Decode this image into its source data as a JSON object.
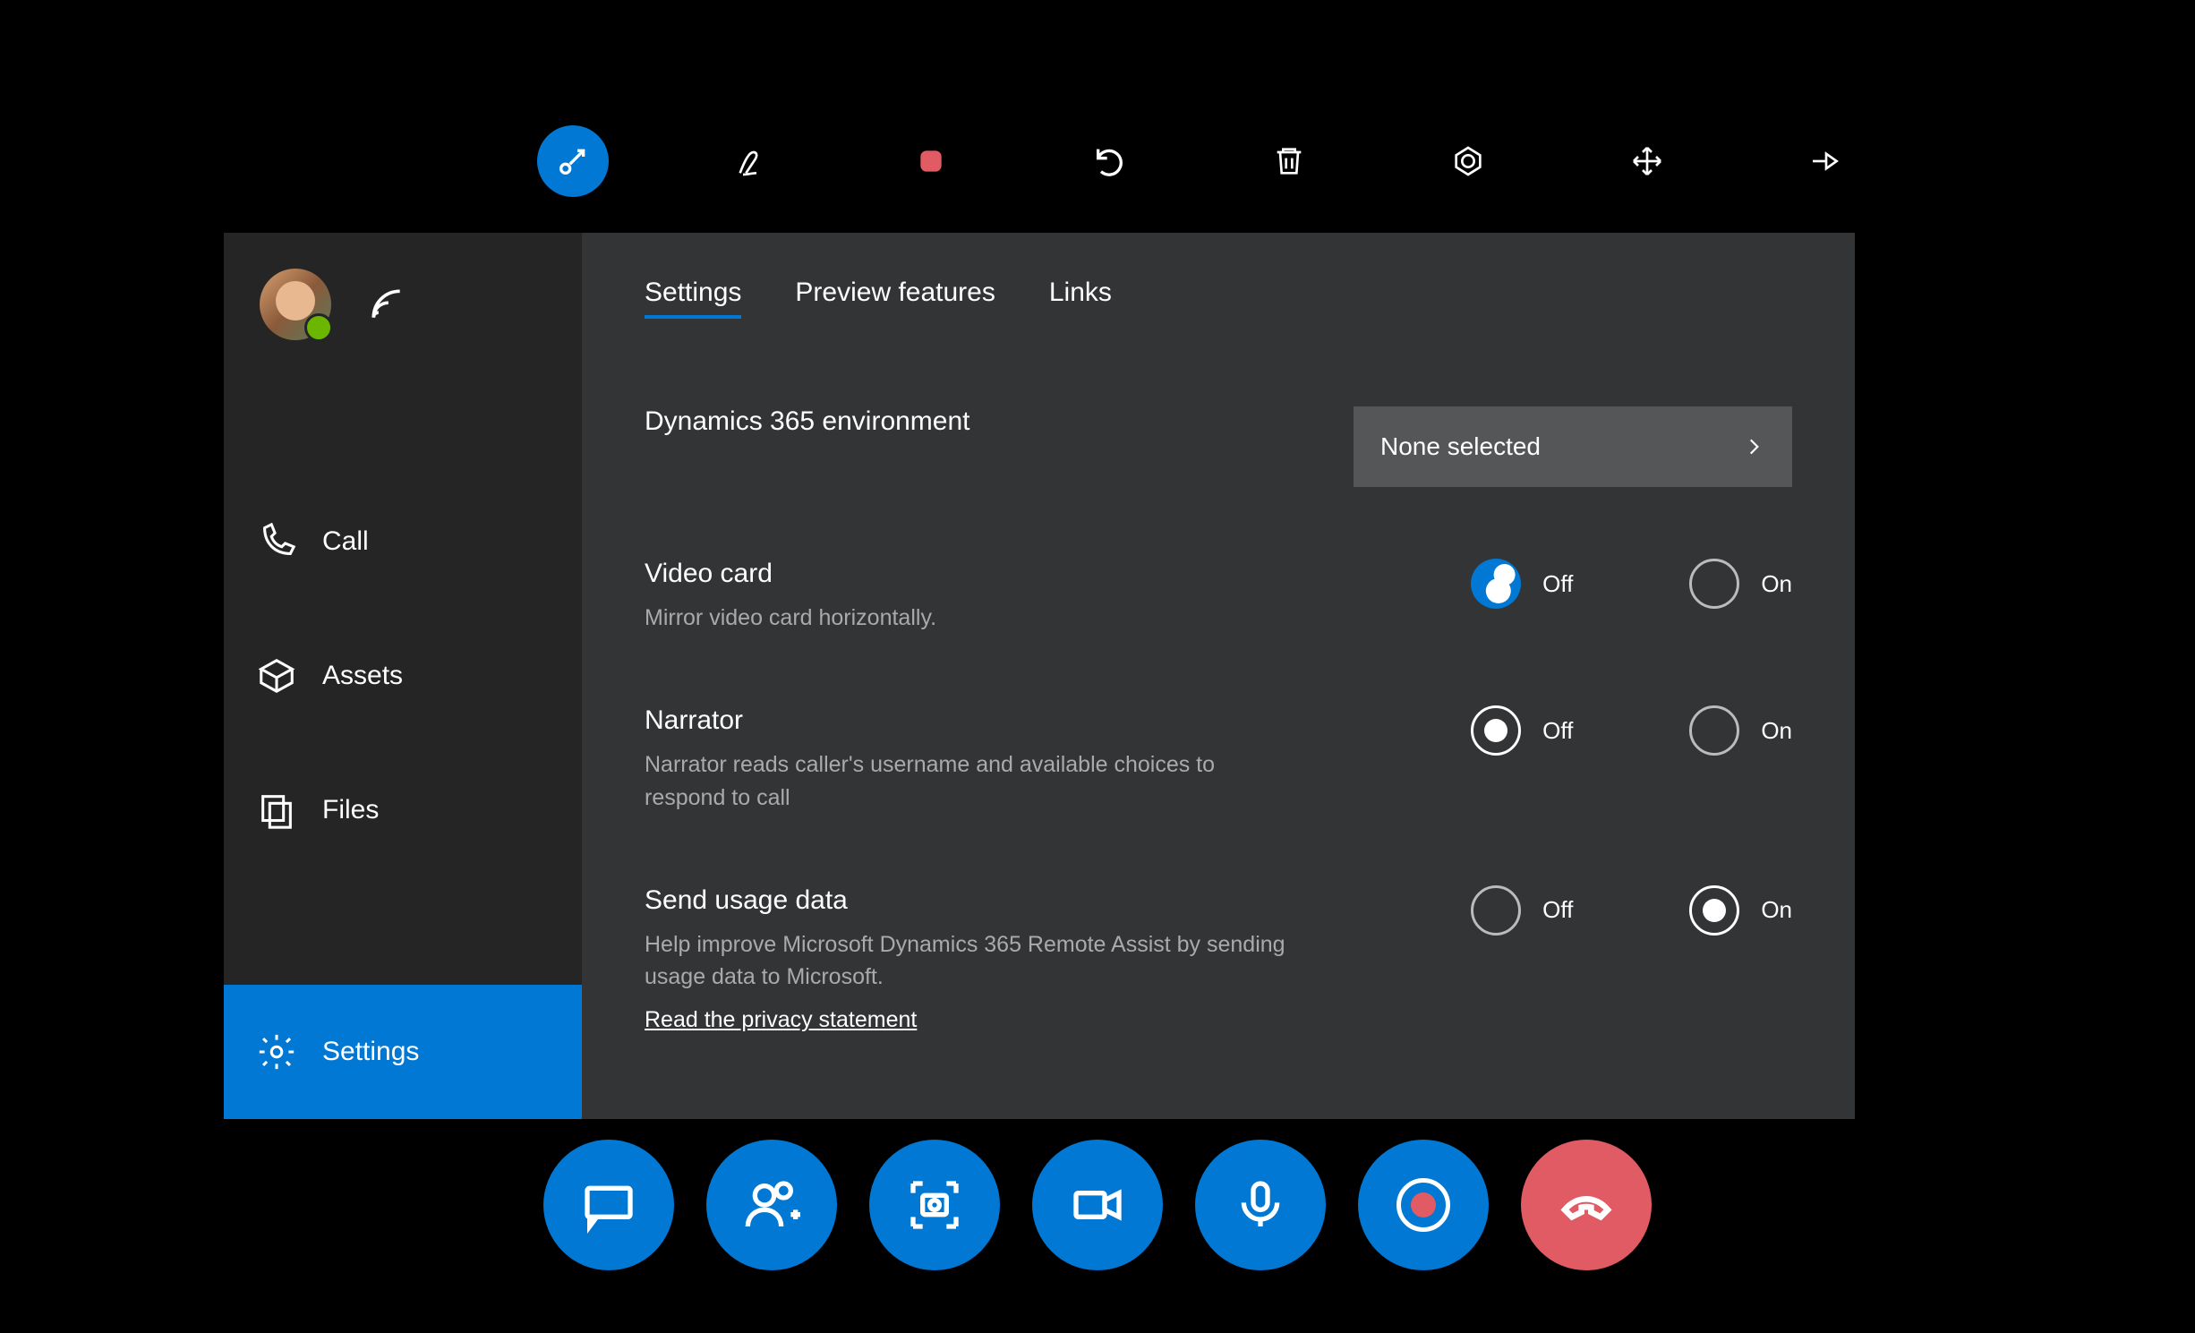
{
  "topbar": {
    "tools": [
      "pointer",
      "ink",
      "stop",
      "undo",
      "delete",
      "focus",
      "move",
      "pin"
    ]
  },
  "sidebar": {
    "nav": {
      "call": "Call",
      "assets": "Assets",
      "files": "Files",
      "settings": "Settings"
    },
    "active": "settings"
  },
  "tabs": {
    "settings": "Settings",
    "preview": "Preview features",
    "links": "Links",
    "active": "settings"
  },
  "settings": {
    "env": {
      "title": "Dynamics 365 environment",
      "value": "None selected"
    },
    "video": {
      "title": "Video card",
      "desc": "Mirror video card horizontally.",
      "off": "Off",
      "on": "On",
      "selected": "off"
    },
    "narrator": {
      "title": "Narrator",
      "desc": "Narrator reads caller's username and available choices to respond to call",
      "off": "Off",
      "on": "On",
      "selected": "off"
    },
    "usage": {
      "title": "Send usage data",
      "desc": "Help improve Microsoft Dynamics 365 Remote Assist by sending usage data to Microsoft.",
      "link": "Read the privacy statement",
      "off": "Off",
      "on": "On",
      "selected": "on"
    }
  },
  "bottombar": {
    "buttons": [
      "chat",
      "add-people",
      "snapshot",
      "video",
      "mic",
      "record",
      "hangup"
    ]
  },
  "colors": {
    "accent": "#0078d4",
    "danger": "#e15b64"
  }
}
